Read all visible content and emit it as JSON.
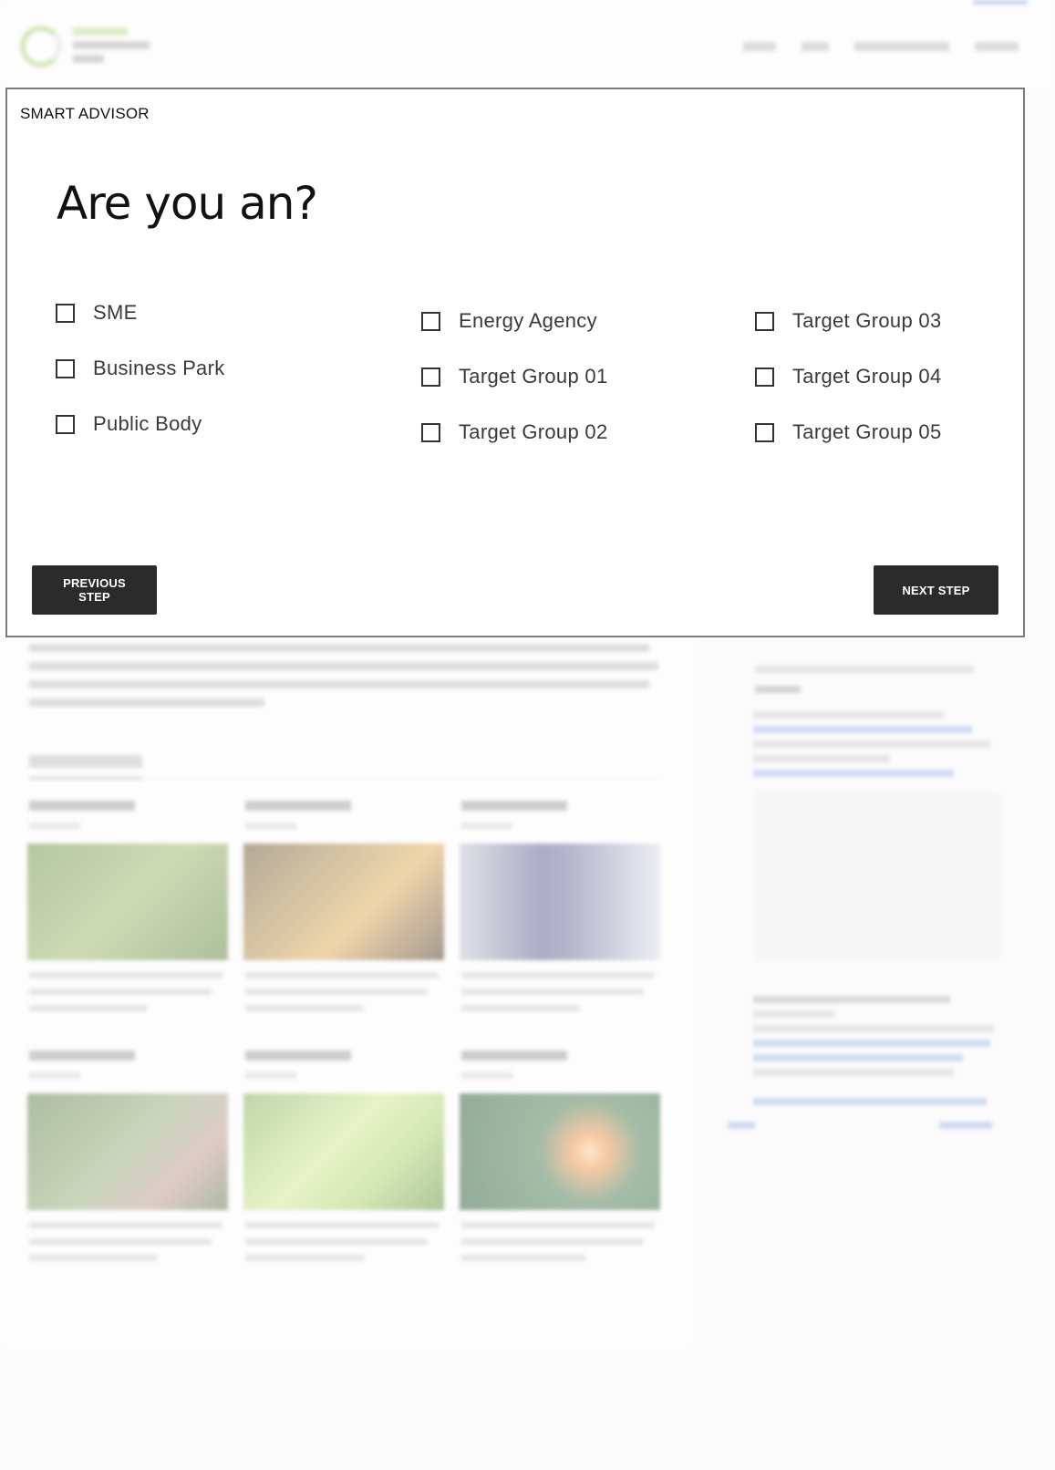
{
  "modal": {
    "label": "SMART ADVISOR",
    "question": "Are you an?",
    "options": [
      {
        "label": "SME",
        "checked": false
      },
      {
        "label": "Business Park",
        "checked": false
      },
      {
        "label": "Public Body",
        "checked": false
      },
      {
        "label": "Energy Agency",
        "checked": false
      },
      {
        "label": "Target Group 01",
        "checked": false
      },
      {
        "label": "Target Group 02",
        "checked": false
      },
      {
        "label": "Target Group 03",
        "checked": false
      },
      {
        "label": "Target Group 04",
        "checked": false
      },
      {
        "label": "Target Group 05",
        "checked": false
      }
    ],
    "previous_label": "PREVIOUS STEP",
    "next_label": "NEXT STEP"
  },
  "colors": {
    "button_bg": "#2b2b2b",
    "button_text": "#ffffff",
    "brand_green": "#b7d98a",
    "modal_border": "#7b7b7b"
  },
  "icons": {
    "checkbox": "checkbox-unchecked-icon",
    "logo": "logo-icon"
  }
}
